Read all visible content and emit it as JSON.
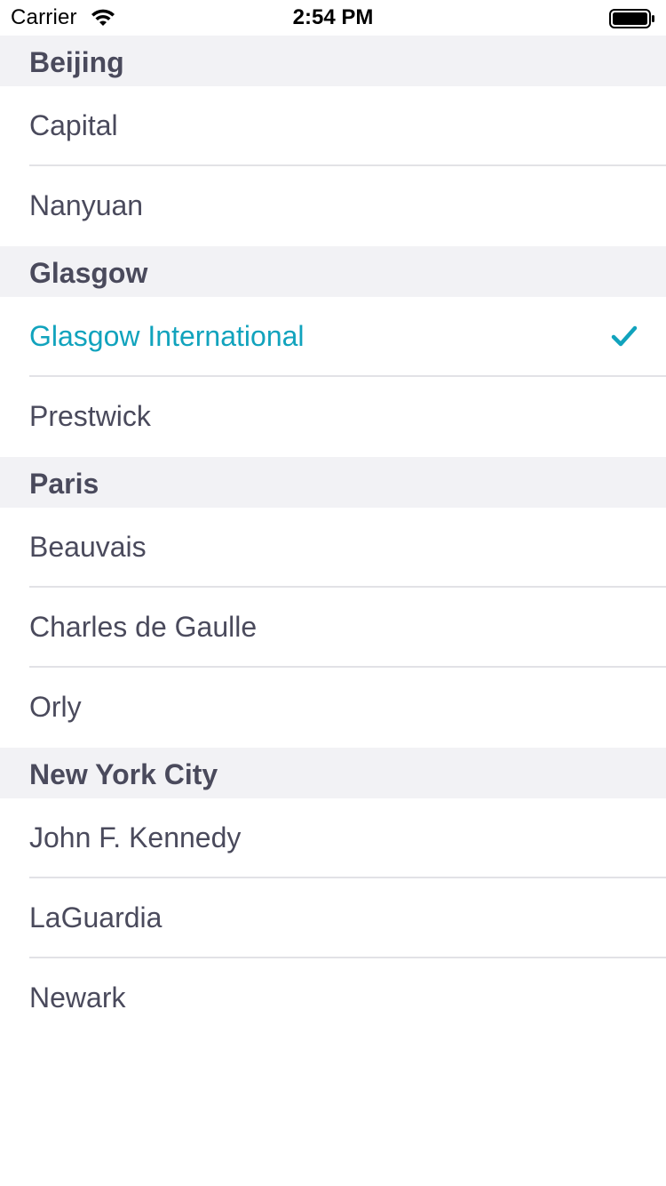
{
  "status_bar": {
    "carrier": "Carrier",
    "time": "2:54 PM"
  },
  "colors": {
    "accent": "#11a3bd",
    "text": "#4a4a5c",
    "section_bg": "#f2f2f5",
    "separator": "#e2e2e6"
  },
  "sections": [
    {
      "title": "Beijing",
      "items": [
        {
          "label": "Capital",
          "selected": false
        },
        {
          "label": "Nanyuan",
          "selected": false
        }
      ]
    },
    {
      "title": "Glasgow",
      "items": [
        {
          "label": "Glasgow International",
          "selected": true,
          "icon": "checkmark-icon"
        },
        {
          "label": "Prestwick",
          "selected": false
        }
      ]
    },
    {
      "title": "Paris",
      "items": [
        {
          "label": "Beauvais",
          "selected": false
        },
        {
          "label": "Charles de Gaulle",
          "selected": false
        },
        {
          "label": "Orly",
          "selected": false
        }
      ]
    },
    {
      "title": "New York City",
      "items": [
        {
          "label": "John F. Kennedy",
          "selected": false
        },
        {
          "label": "LaGuardia",
          "selected": false
        },
        {
          "label": "Newark",
          "selected": false
        }
      ]
    }
  ]
}
